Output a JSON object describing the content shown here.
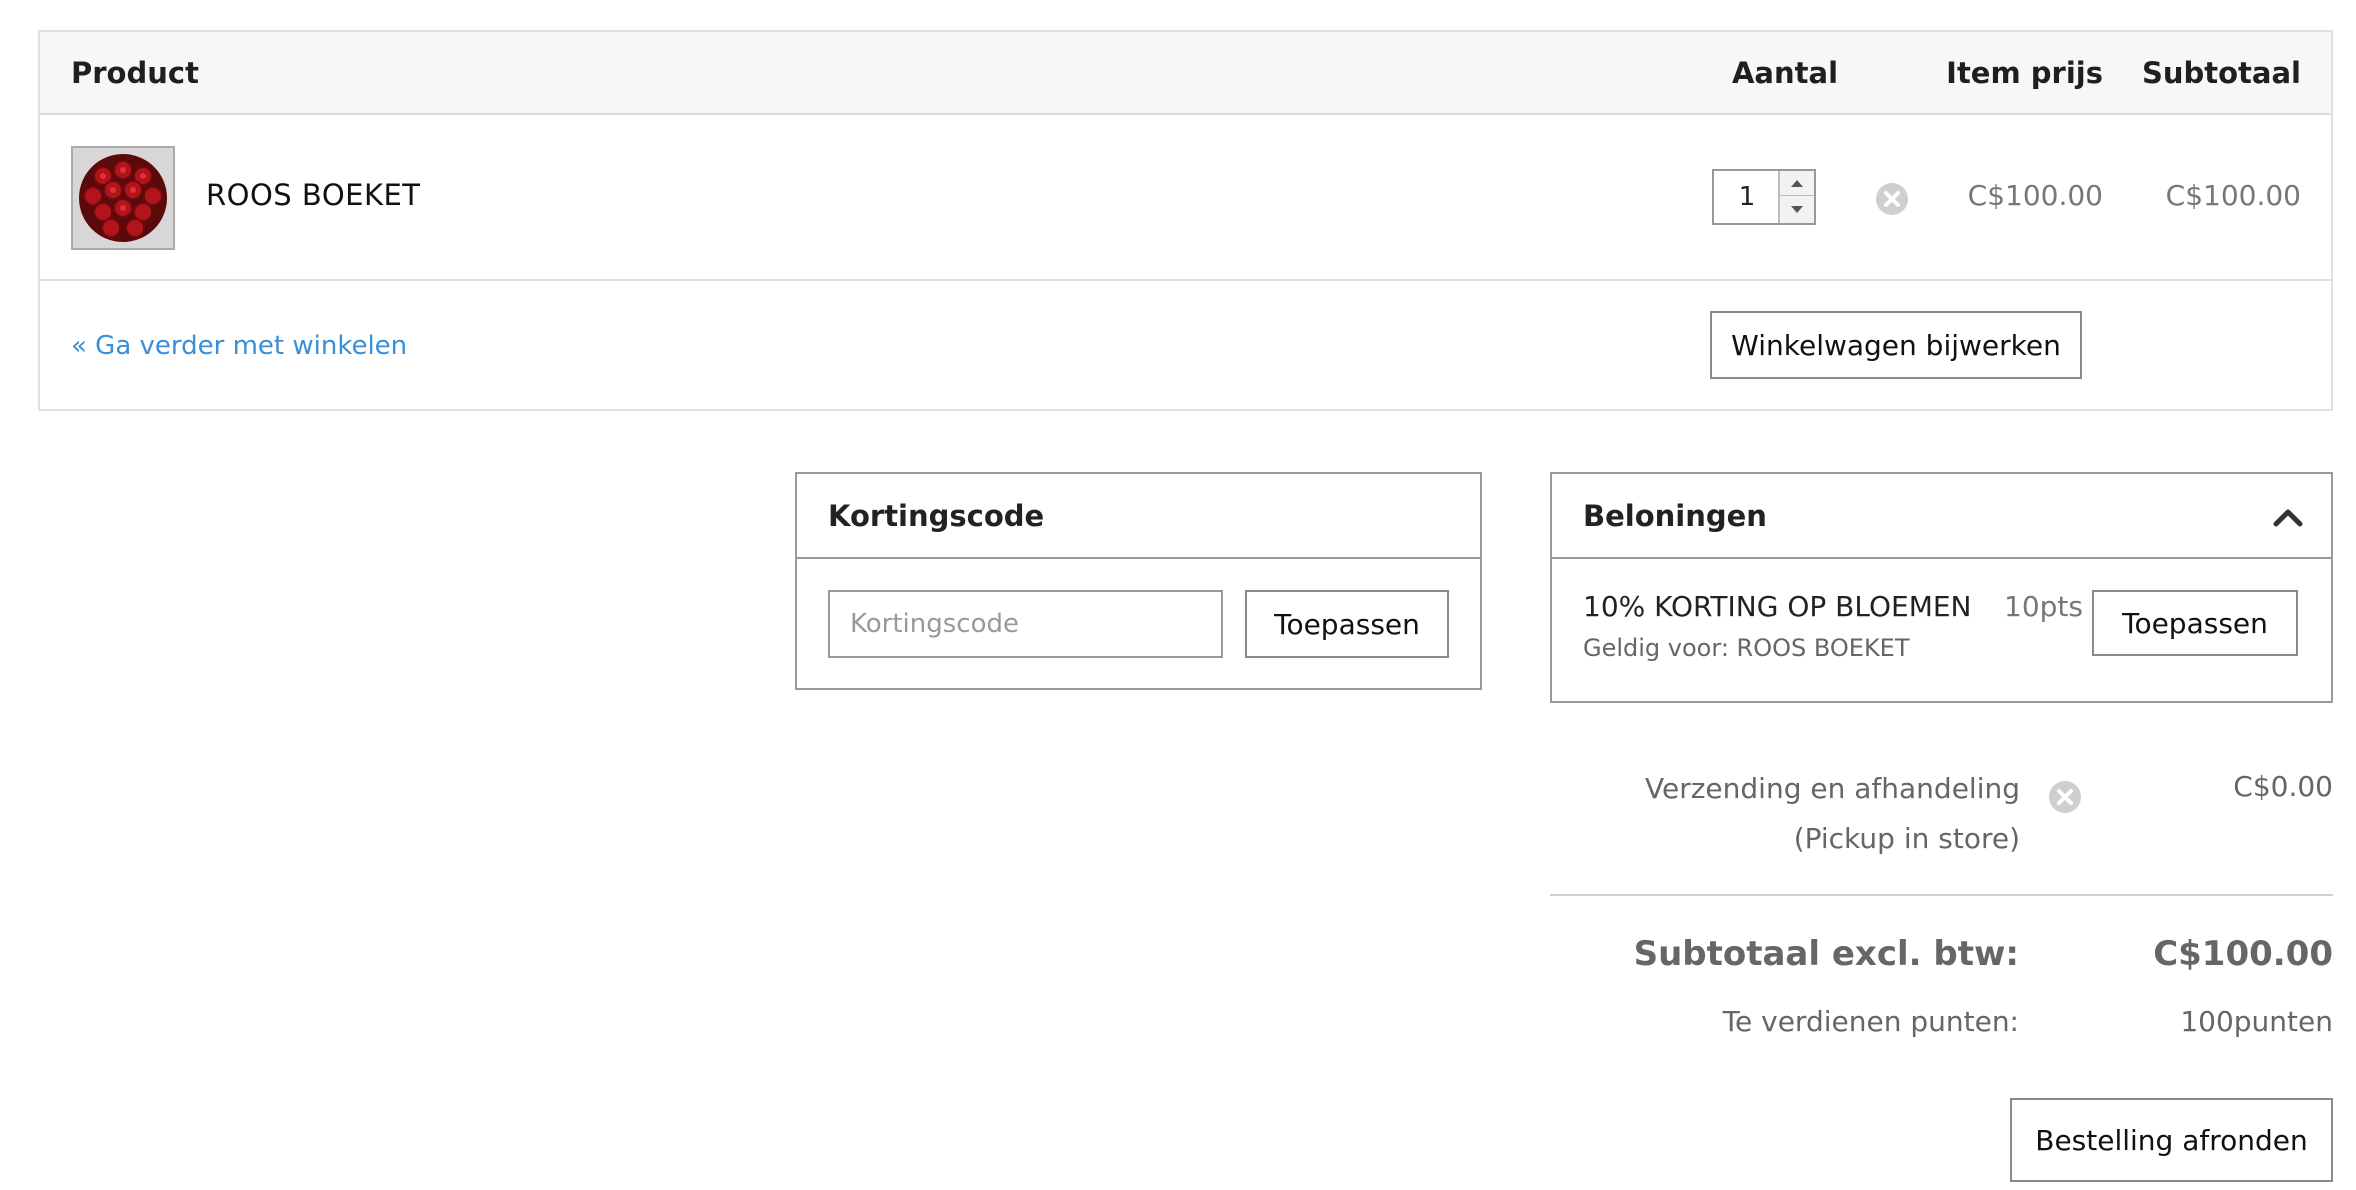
{
  "cart": {
    "headers": {
      "product": "Product",
      "quantity": "Aantal",
      "item_price": "Item prijs",
      "subtotal": "Subtotaal"
    },
    "items": [
      {
        "name": "ROOS BOEKET",
        "quantity": "1",
        "item_price": "C$100.00",
        "subtotal": "C$100.00",
        "thumbnail_icon": "red-roses-bouquet-image"
      }
    ],
    "continue_link": "« Ga verder met winkelen",
    "update_button": "Winkelwagen bijwerken"
  },
  "coupon": {
    "title": "Kortingscode",
    "placeholder": "Kortingscode",
    "value": "",
    "apply_button": "Toepassen"
  },
  "rewards": {
    "title": "Beloningen",
    "collapse_icon": "chevron-up-icon",
    "items": [
      {
        "name": "10% KORTING OP BLOEMEN",
        "valid_for": "Geldig voor: ROOS BOEKET",
        "points": "10pts",
        "apply_button": "Toepassen"
      }
    ]
  },
  "totals": {
    "shipping_label": "Verzending en afhandeling (Pickup in store)",
    "shipping_value": "C$0.00",
    "subtotal_label": "Subtotaal excl. btw:",
    "subtotal_value": "C$100.00",
    "points_label": "Te verdienen punten:",
    "points_value": "100punten"
  },
  "checkout_button": "Bestelling afronden",
  "colors": {
    "link": "#3a8fd8",
    "header_bg": "#f7f7f7",
    "border": "#9a9a9a",
    "muted_text": "#666666"
  }
}
